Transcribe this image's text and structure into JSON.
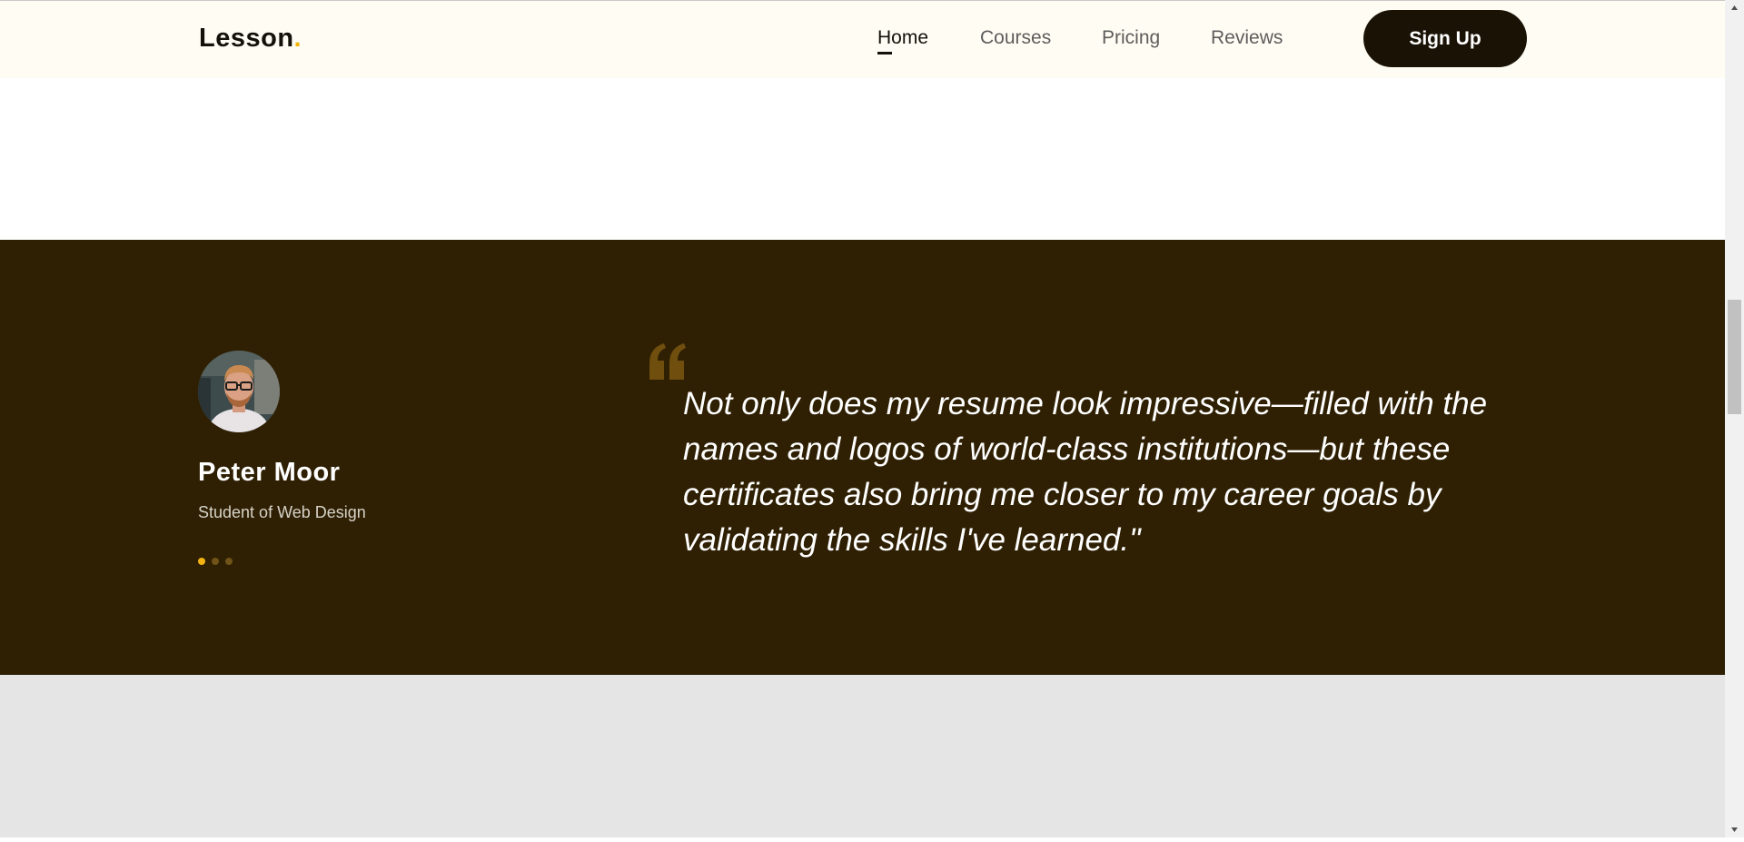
{
  "header": {
    "logo_text": "Lesson",
    "logo_dot": ".",
    "nav": [
      {
        "label": "Home",
        "active": true
      },
      {
        "label": "Courses",
        "active": false
      },
      {
        "label": "Pricing",
        "active": false
      },
      {
        "label": "Reviews",
        "active": false
      }
    ],
    "signup_label": "Sign Up"
  },
  "testimonial": {
    "name": "Peter Moor",
    "role": "Student of Web Design",
    "quote": "Not only does my resume look impressive—filled with the names and logos of world-class institutions—but these certificates also bring me closer to my career goals by validating the skills I've learned.\"",
    "slides": 3,
    "active_slide": 0
  },
  "colors": {
    "header_bg": "#fffcf3",
    "accent": "#f3b312",
    "testimonial_bg": "#2f2003",
    "button_bg": "#1a1205",
    "bottom_bg": "#e5e5e5"
  },
  "icons": {
    "quote": "quote-mark-icon",
    "scroll_up": "triangle-up-icon",
    "scroll_down": "triangle-down-icon"
  }
}
